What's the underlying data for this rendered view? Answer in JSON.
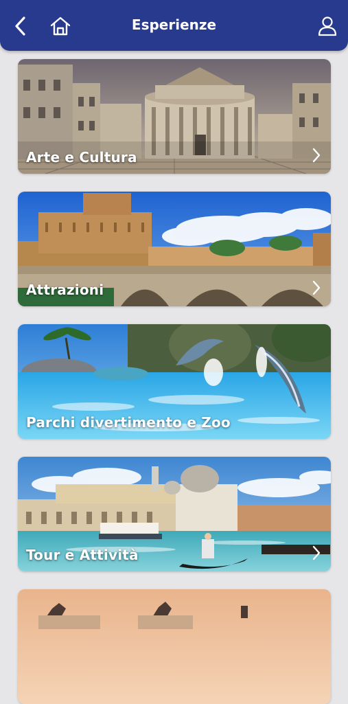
{
  "header": {
    "title": "Esperienze",
    "back_icon": "chevron-left-icon",
    "home_icon": "home-icon",
    "profile_icon": "user-icon",
    "background_color": "#283a8e"
  },
  "categories": [
    {
      "label": "Arte e Cultura",
      "image": "renaissance-ideal-city-painting"
    },
    {
      "label": "Attrazioni",
      "image": "castel-sant-angelo-rome"
    },
    {
      "label": "Parchi divertimento e Zoo",
      "image": "dolphin-show-pool"
    },
    {
      "label": "Tour e Attività",
      "image": "venice-grand-canal-gondola"
    },
    {
      "label": "",
      "image": "rome-vittoriano-sunset"
    }
  ]
}
